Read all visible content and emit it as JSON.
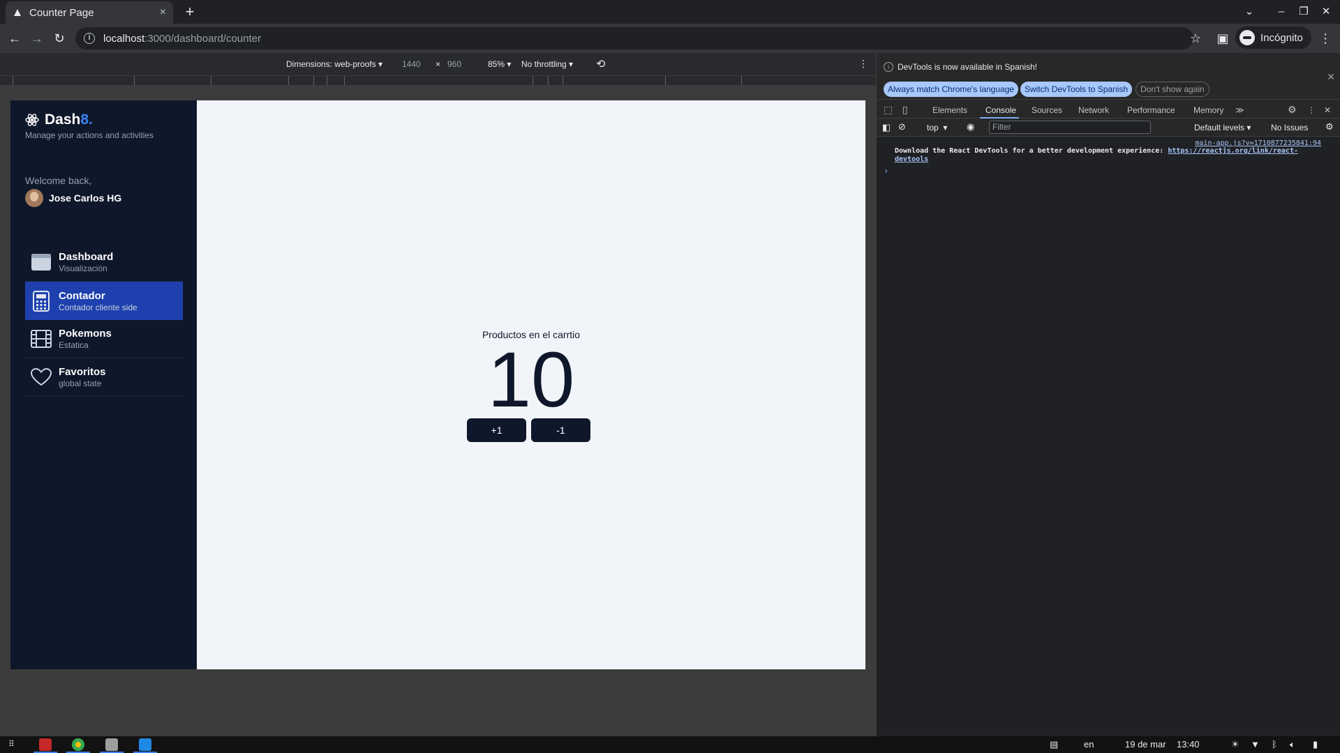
{
  "browser": {
    "tab_title": "Counter Page",
    "tab_close": "×",
    "new_tab": "+",
    "url_host": "localhost",
    "url_path": ":3000/dashboard/counter",
    "profile_label": "Incógnito"
  },
  "device_toolbar": {
    "dimensions_label": "Dimensions: web-proofs",
    "width": "1440",
    "times": "×",
    "height": "960",
    "zoom": "85%",
    "throttling": "No throttling"
  },
  "sidebar": {
    "brand_main": "Dash",
    "brand_accent": "8.",
    "brand_subtitle": "Manage your actions and activities",
    "welcome": "Welcome back,",
    "user_name": "Jose Carlos HG",
    "items": [
      {
        "title": "Dashboard",
        "subtitle": "Visualización",
        "icon": "browser-window-icon",
        "active": false
      },
      {
        "title": "Contador",
        "subtitle": "Contador cliente side",
        "icon": "calculator-icon",
        "active": true
      },
      {
        "title": "Pokemons",
        "subtitle": "Estatica",
        "icon": "film-icon",
        "active": false
      },
      {
        "title": "Favoritos",
        "subtitle": "global state",
        "icon": "heart-icon",
        "active": false
      }
    ]
  },
  "counter": {
    "label": "Productos en el carrtio",
    "value": "10",
    "increment_label": "+1",
    "decrement_label": "-1"
  },
  "devtools": {
    "banner_message": "DevTools is now available in Spanish!",
    "banner_btn_match": "Always match Chrome's language",
    "banner_btn_switch": "Switch DevTools to Spanish",
    "banner_btn_dismiss": "Don't show again",
    "tabs": [
      "Elements",
      "Console",
      "Sources",
      "Network",
      "Performance",
      "Memory"
    ],
    "more_tabs": "≫",
    "context": "top",
    "filter_placeholder": "Filter",
    "levels": "Default levels",
    "issues": "No Issues",
    "console_source": "main-app.js?v=1710877235841:94",
    "console_message": "Download the React DevTools for a better development experience: ",
    "console_link": "https://reactjs.org/link/react-devtools"
  },
  "taskbar": {
    "lang": "en",
    "date": "19 de mar",
    "time": "13:40"
  },
  "colors": {
    "sidebar_bg": "#0f172a",
    "active_item": "#1e40af",
    "brand_accent": "#3b82f6",
    "page_bg": "#f1f5f9"
  }
}
